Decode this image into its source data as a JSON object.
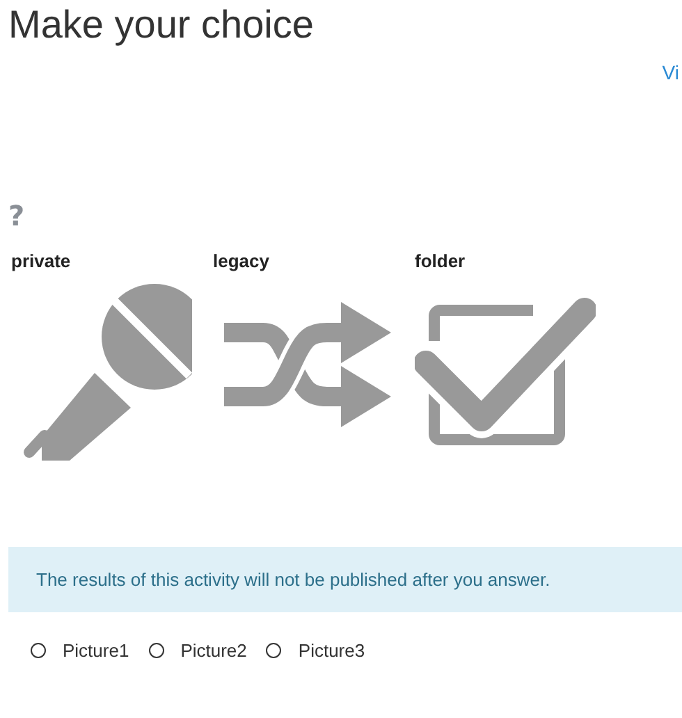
{
  "title": "Make your choice",
  "link": "Vi",
  "question": "?",
  "choices": [
    {
      "label": "private",
      "kind": "microphone"
    },
    {
      "label": "legacy",
      "kind": "shuffle"
    },
    {
      "label": "folder",
      "kind": "checkbox"
    }
  ],
  "notice": "The results of this activity will not be published after you answer.",
  "options": [
    {
      "label": "Picture1",
      "selected": false
    },
    {
      "label": "Picture2",
      "selected": false
    },
    {
      "label": "Picture3",
      "selected": false
    }
  ]
}
